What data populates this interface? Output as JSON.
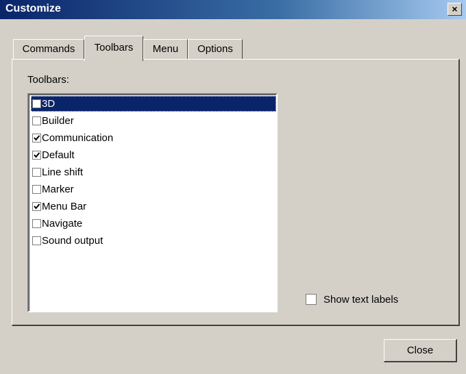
{
  "window": {
    "title": "Customize",
    "close_glyph": "×"
  },
  "tabs": [
    {
      "label": "Commands",
      "active": false
    },
    {
      "label": "Toolbars",
      "active": true
    },
    {
      "label": "Menu",
      "active": false
    },
    {
      "label": "Options",
      "active": false
    }
  ],
  "toolbars_panel": {
    "label": "Toolbars:",
    "items": [
      {
        "label": "3D",
        "checked": false,
        "selected": true
      },
      {
        "label": "Builder",
        "checked": false,
        "selected": false
      },
      {
        "label": "Communication",
        "checked": true,
        "selected": false
      },
      {
        "label": "Default",
        "checked": true,
        "selected": false
      },
      {
        "label": "Line shift",
        "checked": false,
        "selected": false
      },
      {
        "label": "Marker",
        "checked": false,
        "selected": false
      },
      {
        "label": "Menu Bar",
        "checked": true,
        "selected": false
      },
      {
        "label": "Navigate",
        "checked": false,
        "selected": false
      },
      {
        "label": "Sound output",
        "checked": false,
        "selected": false
      }
    ],
    "show_text_labels": {
      "label": "Show text labels",
      "checked": false
    }
  },
  "footer": {
    "close_label": "Close"
  },
  "colors": {
    "selection": "#0a246a",
    "face": "#d4d0c8"
  }
}
